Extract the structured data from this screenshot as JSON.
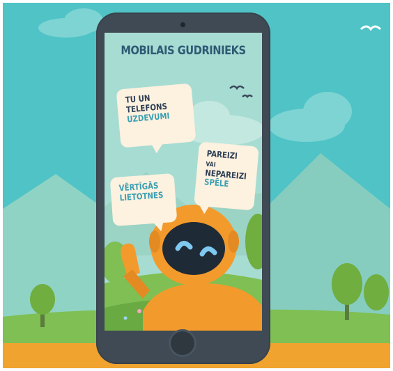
{
  "app": {
    "title": "MOBILAIS GUDRINIEKS"
  },
  "menu": {
    "items": [
      {
        "title": "TU UN TELEFONS",
        "subtitle": "UZDEVUMI"
      },
      {
        "title_a": "PAREIZI",
        "title_b": "VAI",
        "title_c": "NEPAREIZI",
        "subtitle": "SPĒLE"
      },
      {
        "title_a": "VĒRTĪGĀS",
        "title_b": "LIETOTNES"
      }
    ]
  },
  "colors": {
    "sky": "#4fc3c6",
    "ground": "#f0a32e",
    "phone_body": "#3f4a54",
    "bubble": "#fdf1df",
    "robot": "#f39a2c",
    "title_text": "#2e5a73",
    "accent_text": "#3a9fb3"
  },
  "icons": [
    "camera-icon",
    "home-button-icon",
    "robot-mascot",
    "bird-icon"
  ]
}
